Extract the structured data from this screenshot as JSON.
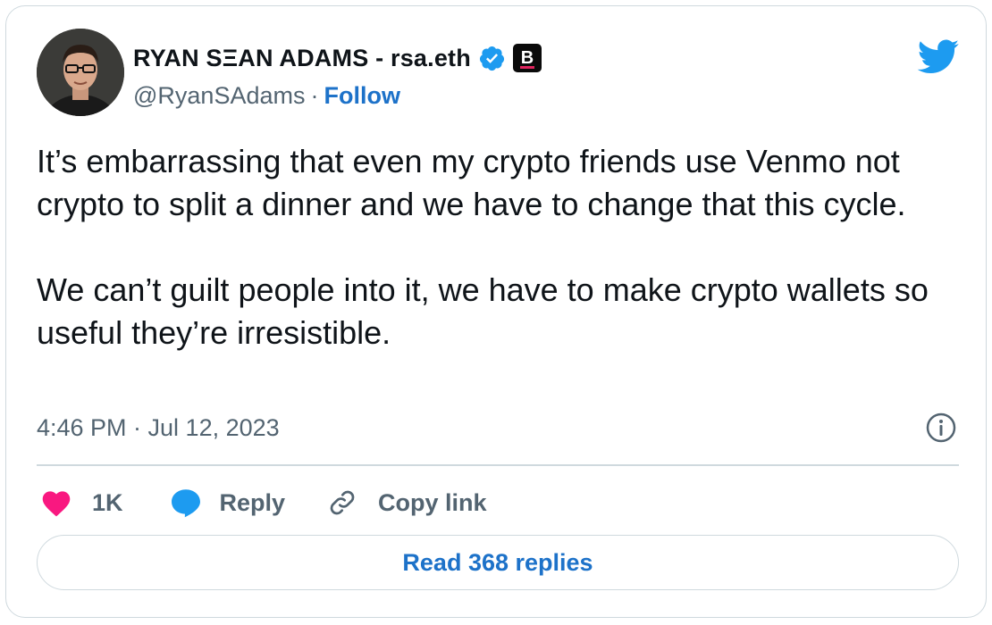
{
  "author": {
    "display_name": "RYAN SΞAN ADAMS - rsa.eth",
    "handle": "@RyanSAdams",
    "separator": "·",
    "follow_label": "Follow",
    "badge_letter": "B"
  },
  "tweet": {
    "text": "It’s embarrassing that even my crypto friends use Venmo not crypto to split a dinner and we have to change that this cycle.\n\nWe can’t guilt people into it, we have to make crypto wallets so useful they’re irresistible.",
    "timestamp": "4:46 PM · Jul 12, 2023"
  },
  "actions": {
    "like_count": "1K",
    "reply_label": "Reply",
    "copy_link_label": "Copy link"
  },
  "read_replies_label": "Read 368 replies",
  "colors": {
    "accent": "#1d72c9",
    "twitter_blue": "#1d9bf0",
    "like_pink": "#f91880",
    "border": "#cfd9de",
    "muted": "#536471",
    "text": "#0f1419"
  },
  "icons": [
    "verified-icon",
    "twitter-logo-icon",
    "info-icon",
    "heart-icon",
    "reply-bubble-icon",
    "link-icon"
  ]
}
